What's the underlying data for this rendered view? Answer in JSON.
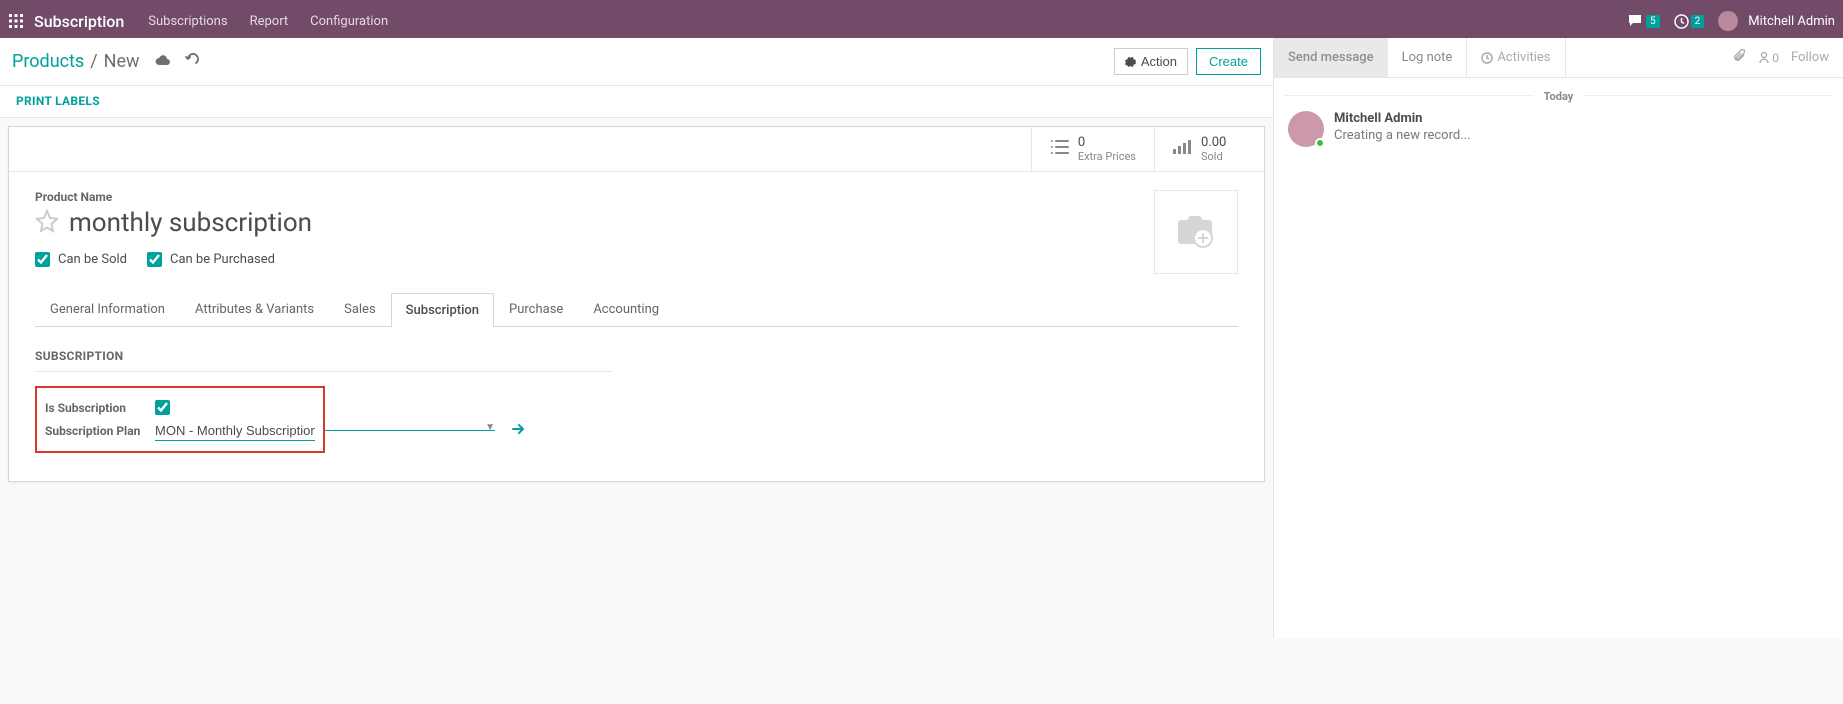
{
  "nav": {
    "brand": "Subscription",
    "links": [
      "Subscriptions",
      "Report",
      "Configuration"
    ],
    "chat_badge": "5",
    "clock_badge": "2",
    "user": "Mitchell Admin"
  },
  "cp": {
    "crumb_root": "Products",
    "crumb_current": "New",
    "action": "Action",
    "create": "Create"
  },
  "toolbar": {
    "print_labels": "PRINT LABELS"
  },
  "stats": {
    "extra_prices_num": "0",
    "extra_prices_lbl": "Extra Prices",
    "sold_num": "0.00",
    "sold_lbl": "Sold"
  },
  "form": {
    "pn_label": "Product Name",
    "name": "monthly subscription",
    "can_sold": "Can be Sold",
    "can_purchased": "Can be Purchased"
  },
  "tabs": [
    "General Information",
    "Attributes & Variants",
    "Sales",
    "Subscription",
    "Purchase",
    "Accounting"
  ],
  "subscription": {
    "section": "SUBSCRIPTION",
    "is_label": "Is Subscription",
    "plan_label": "Subscription Plan",
    "plan_value": "MON - Monthly Subscription"
  },
  "chatter": {
    "send": "Send message",
    "log": "Log note",
    "activities": "Activities",
    "follower_count": "0",
    "follow": "Follow",
    "divider": "Today",
    "msg_author": "Mitchell Admin",
    "msg_body": "Creating a new record..."
  }
}
